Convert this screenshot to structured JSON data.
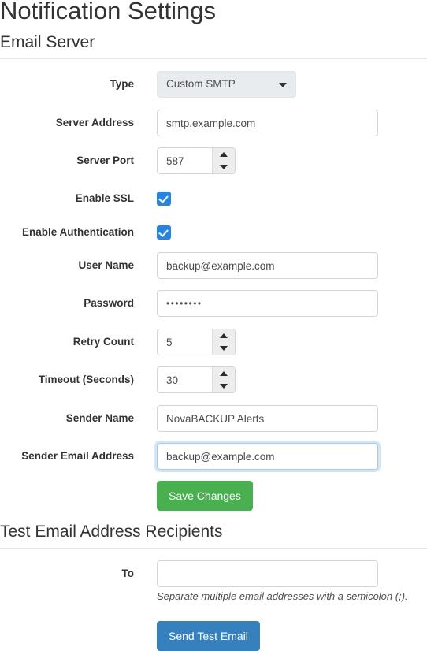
{
  "page": {
    "title": "Notification Settings"
  },
  "email_server": {
    "heading": "Email Server",
    "fields": {
      "type": {
        "label": "Type",
        "value": "Custom SMTP",
        "caret_icon": "chevron-down-icon"
      },
      "server_address": {
        "label": "Server Address",
        "value": "smtp.example.com"
      },
      "server_port": {
        "label": "Server Port",
        "value": "587"
      },
      "enable_ssl": {
        "label": "Enable SSL",
        "checked": "true"
      },
      "enable_authentication": {
        "label": "Enable Authentication",
        "checked": "true"
      },
      "user_name": {
        "label": "User Name",
        "value": "backup@example.com"
      },
      "password": {
        "label": "Password",
        "value": "••••••••"
      },
      "retry_count": {
        "label": "Retry Count",
        "value": "5"
      },
      "timeout_seconds": {
        "label": "Timeout (Seconds)",
        "value": "30"
      },
      "sender_name": {
        "label": "Sender Name",
        "value": "NovaBACKUP Alerts"
      },
      "sender_email_address": {
        "label": "Sender Email Address",
        "value": "backup@example.com",
        "focused": "true"
      }
    },
    "save_button": "Save Changes"
  },
  "test_recipients": {
    "heading": "Test Email Address Recipients",
    "to": {
      "label": "To",
      "value": "",
      "placeholder": ""
    },
    "help_text": "Separate multiple email addresses with a semicolon (;).",
    "send_button": "Send Test Email"
  },
  "colors": {
    "accent_blue": "#2684e8",
    "save_green": "#49b04f",
    "send_blue": "#3580bd",
    "text": "#333333",
    "rule": "#e5e5e5",
    "input_border": "#d4d4d4",
    "select_bg": "#e9ecef",
    "focus_ring": "#a9c9ea"
  }
}
